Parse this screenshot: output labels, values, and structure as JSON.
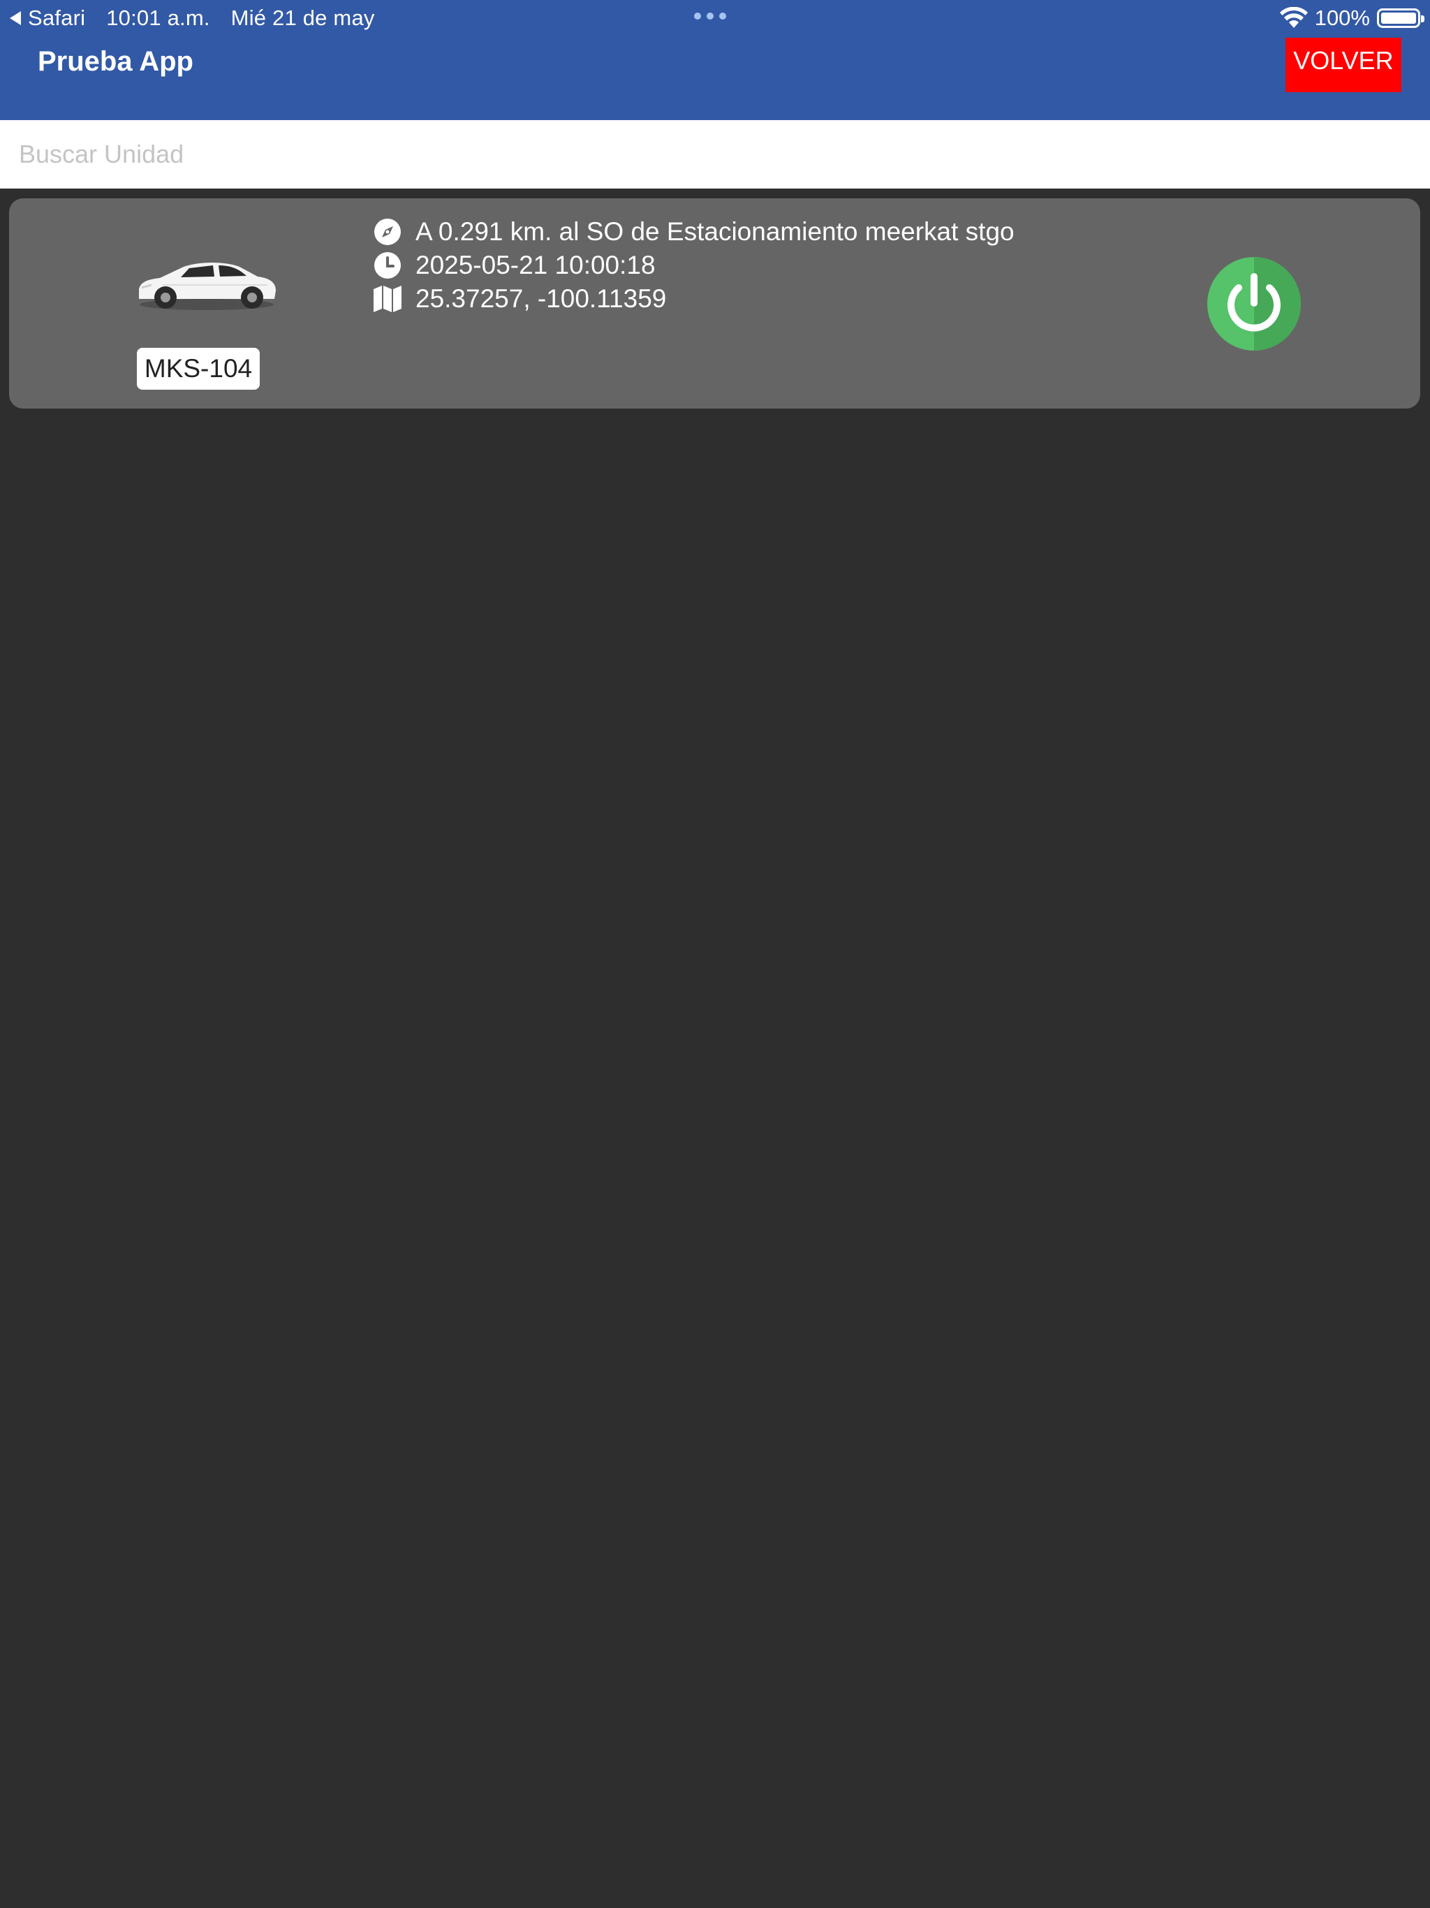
{
  "status_bar": {
    "back_app": "Safari",
    "time": "10:01 a.m.",
    "date": "Mié 21 de may",
    "battery": "100%",
    "icons": [
      "back-triangle-icon",
      "multitasking-dots-icon",
      "wifi-icon",
      "battery-icon"
    ]
  },
  "header": {
    "title": "Prueba App",
    "back_label": "VOLVER",
    "colors": {
      "bar": "#3259a6",
      "back_button": "#ff0000"
    }
  },
  "search": {
    "placeholder": "Buscar Unidad",
    "value": ""
  },
  "units": [
    {
      "plate": "MKS-104",
      "location": "A 0.291 km. al SO de Estacionamiento meerkat stgo",
      "timestamp": "2025-05-21 10:00:18",
      "coordinates": "25.37257, -100.11359",
      "vehicle_icon": "white-sedan-car-image",
      "status_icon": "power-icon",
      "status_color": "#56c26a",
      "row_icons": [
        "compass-icon",
        "clock-icon",
        "map-icon"
      ]
    }
  ],
  "colors": {
    "background": "#2e2e2e",
    "card": "#656565"
  }
}
